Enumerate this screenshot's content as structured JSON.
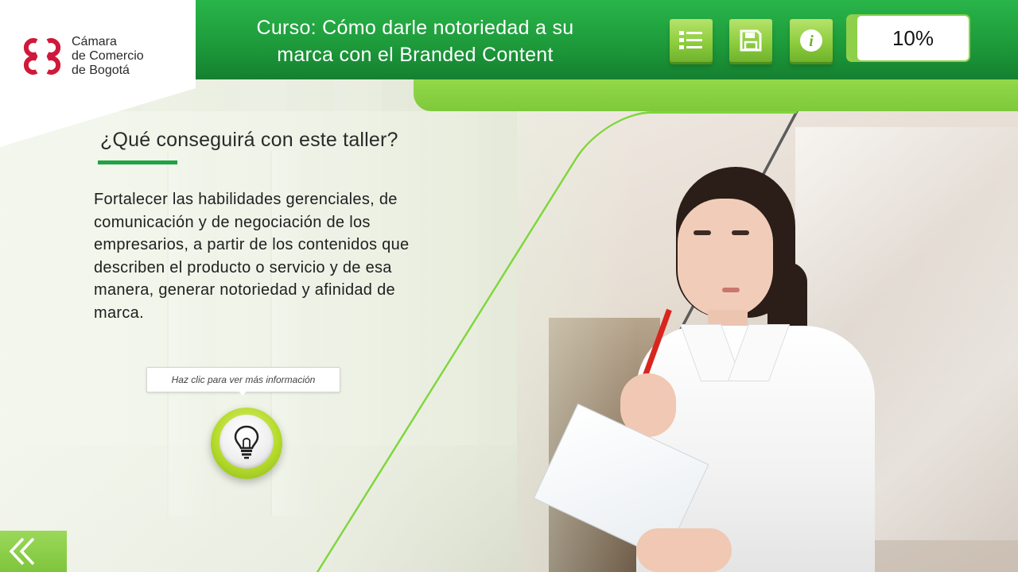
{
  "logo": {
    "name_lines": [
      "Cámara",
      "de Comercio",
      "de Bogotá"
    ],
    "mark_color": "#d0193a"
  },
  "header": {
    "course_title_lines": [
      "Curso: Cómo darle notoriedad a su",
      "marca con el Branded Content"
    ],
    "toolbar": {
      "menu_icon": "list-menu-icon",
      "save_icon": "save-icon",
      "info_icon": "info-icon"
    },
    "progress": {
      "label": "10%",
      "value": 0.1
    }
  },
  "main": {
    "section_title": "¿Qué conseguirá con este taller?",
    "body_lines": [
      "Fortalecer las habilidades gerenciales, de",
      "comunicación y de negociación de los",
      "empresarios, a partir de los contenidos que",
      "describen el producto o servicio y de esa",
      "manera, generar notoriedad y afinidad de",
      "marca."
    ],
    "hint_text": "Haz clic para ver más información",
    "bulb_icon": "lightbulb-icon"
  },
  "nav": {
    "back_icon": "double-chevron-left-icon"
  },
  "colors": {
    "header_green": "#1e9b3b",
    "accent_lime": "#8ed04a",
    "underline_green": "#1fa344",
    "pencil_red": "#d8261f"
  }
}
